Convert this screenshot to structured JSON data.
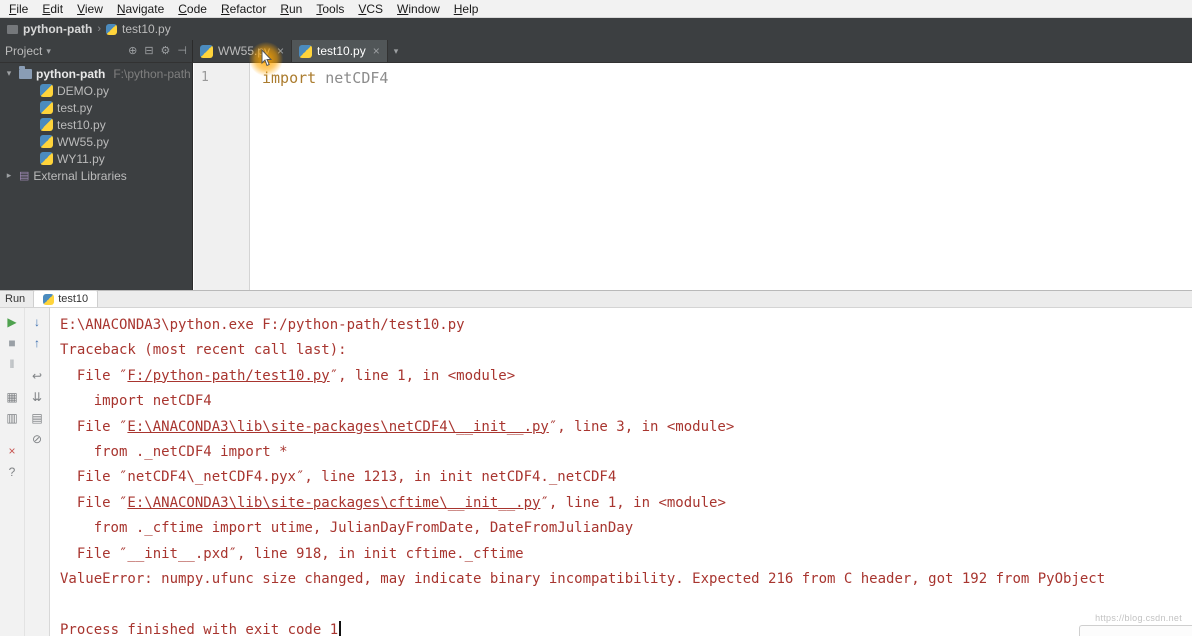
{
  "colors": {
    "chrome_dark": "#3c3f41",
    "selected_tab": "#515658",
    "keyword": "#ab7c2e",
    "identifier": "#8c8c8c",
    "stderr": "#a8352f",
    "link": "#a8352f",
    "run_green": "#4fa24f",
    "close_red": "#c75450"
  },
  "menu_bar": {
    "items": [
      "File",
      "Edit",
      "View",
      "Navigate",
      "Code",
      "Refactor",
      "Run",
      "Tools",
      "VCS",
      "Window",
      "Help"
    ]
  },
  "breadcrumb": {
    "project": "python-path",
    "separator": "›",
    "file": "test10.py"
  },
  "project_panel": {
    "header_title": "Project",
    "header_icons": [
      {
        "name": "locate-file-icon",
        "glyph": "⊕"
      },
      {
        "name": "collapse-all-icon",
        "glyph": "⊟"
      },
      {
        "name": "settings-icon",
        "glyph": "⚙"
      },
      {
        "name": "hide-panel-icon",
        "glyph": "⊣"
      }
    ],
    "root_name": "python-path",
    "root_path": "F:\\python-path",
    "files": [
      "DEMO.py",
      "test.py",
      "test10.py",
      "WW55.py",
      "WY11.py"
    ],
    "external_libraries_label": "External Libraries"
  },
  "editor": {
    "tabs": [
      {
        "label": "WW55.py",
        "selected": false
      },
      {
        "label": "test10.py",
        "selected": true
      }
    ],
    "close_glyph": "×",
    "line_number": "1",
    "code_keyword": "import",
    "code_identifier": "netCDF4"
  },
  "run_panel": {
    "panel_label": "Run",
    "tab_label": "test10",
    "toolbar_left": [
      {
        "name": "rerun-icon",
        "glyph": "▶",
        "color": "#4fa24f"
      },
      {
        "name": "stop-icon",
        "glyph": "■",
        "color": "#9aa0a6"
      },
      {
        "name": "pause-icon",
        "glyph": "‖",
        "color": "#9aa0a6"
      },
      {
        "name": "restore-layout-icon",
        "glyph": "▦",
        "color": "#7f8285",
        "gap": 12
      },
      {
        "name": "pin-tab-icon",
        "glyph": "▥",
        "color": "#7f8285"
      },
      {
        "name": "close-icon",
        "glyph": "×",
        "color": "#c75450",
        "gap": 12
      },
      {
        "name": "help-icon",
        "glyph": "?",
        "color": "#7f8285"
      }
    ],
    "toolbar_right": [
      {
        "name": "down-stacktrace-icon",
        "glyph": "↓",
        "color": "#3b6eaf"
      },
      {
        "name": "up-stacktrace-icon",
        "glyph": "↑",
        "color": "#3b6eaf"
      },
      {
        "name": "soft-wrap-icon",
        "glyph": "↩",
        "color": "#7f8285",
        "gap": 12
      },
      {
        "name": "scroll-to-end-icon",
        "glyph": "⇊",
        "color": "#7f8285"
      },
      {
        "name": "print-icon",
        "glyph": "▤",
        "color": "#7f8285"
      },
      {
        "name": "clear-all-icon",
        "glyph": "⊘",
        "color": "#7f8285"
      }
    ],
    "console_lines": [
      {
        "text": "E:\\ANACONDA3\\python.exe F:/python-path/test10.py"
      },
      {
        "text": "Traceback (most recent call last):"
      },
      {
        "indent": 2,
        "pre": "File ″",
        "link": "F:/python-path/test10.py",
        "post": "″, line 1, in <module>"
      },
      {
        "indent": 4,
        "text": "import netCDF4"
      },
      {
        "indent": 2,
        "pre": "File ″",
        "link": "E:\\ANACONDA3\\lib\\site-packages\\netCDF4\\__init__.py",
        "post": "″, line 3, in <module>"
      },
      {
        "indent": 4,
        "text": "from ._netCDF4 import *"
      },
      {
        "indent": 2,
        "text": "File ″netCDF4\\_netCDF4.pyx″, line 1213, in init netCDF4._netCDF4"
      },
      {
        "indent": 2,
        "pre": "File ″",
        "link": "E:\\ANACONDA3\\lib\\site-packages\\cftime\\__init__.py",
        "post": "″, line 1, in <module>"
      },
      {
        "indent": 4,
        "text": "from ._cftime import utime, JulianDayFromDate, DateFromJulianDay"
      },
      {
        "indent": 2,
        "text": "File ″__init__.pxd″, line 918, in init cftime._cftime"
      },
      {
        "text": "ValueError: numpy.ufunc size changed, may indicate binary incompatibility. Expected 216 from C header, got 192 from PyObject"
      },
      {
        "text": ""
      },
      {
        "text": "Process finished with exit code 1",
        "caret": true
      }
    ]
  },
  "watermark": "https://blog.csdn.net"
}
